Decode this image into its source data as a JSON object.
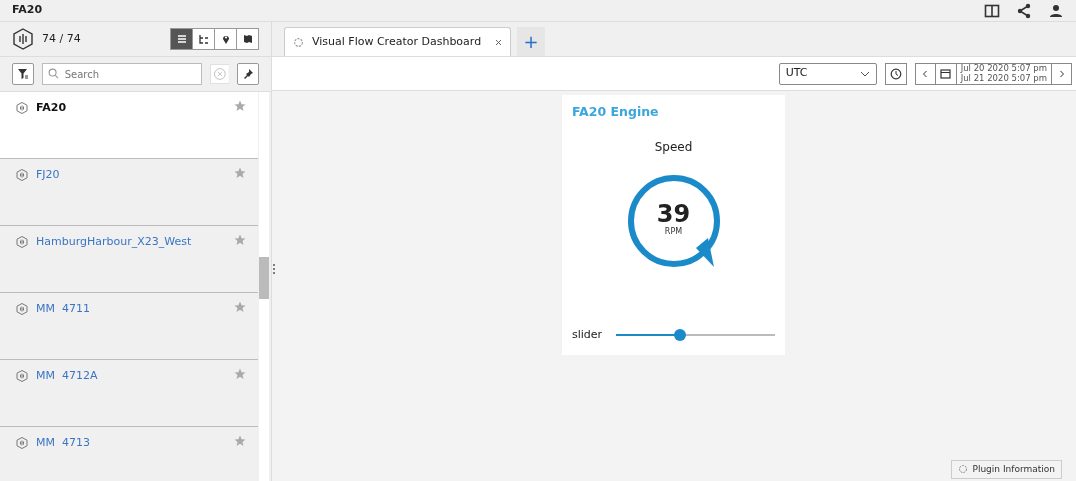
{
  "app": {
    "title": "FA20"
  },
  "sidebar": {
    "count": "74 / 74",
    "views": [
      {
        "kind": "list",
        "selected": true
      },
      {
        "kind": "tree",
        "selected": false
      },
      {
        "kind": "pin",
        "selected": false
      },
      {
        "kind": "map",
        "selected": false
      }
    ],
    "search": {
      "placeholder": "Search"
    },
    "items": [
      {
        "label": "FA20",
        "selected": true
      },
      {
        "label": "FJ20",
        "selected": false
      },
      {
        "label": "HamburgHarbour_X23_West",
        "selected": false
      },
      {
        "label": "MM  4711",
        "selected": false
      },
      {
        "label": "MM  4712A",
        "selected": false
      },
      {
        "label": "MM  4713",
        "selected": false
      }
    ]
  },
  "tabs": [
    {
      "label": "Visual Flow Creator Dashboard",
      "selected": true
    }
  ],
  "add_tab": "+",
  "toolbar": {
    "timezone": "UTC",
    "range_start": "Jul 20 2020 5:07 pm",
    "range_end": "Jul 21 2020 5:07 pm"
  },
  "widget": {
    "title": "FA20 Engine",
    "gauge_label": "Speed",
    "value": "39",
    "unit": "RPM",
    "slider_label": "slider",
    "level": 0.4
  },
  "plugin_button": "Plugin Information"
}
